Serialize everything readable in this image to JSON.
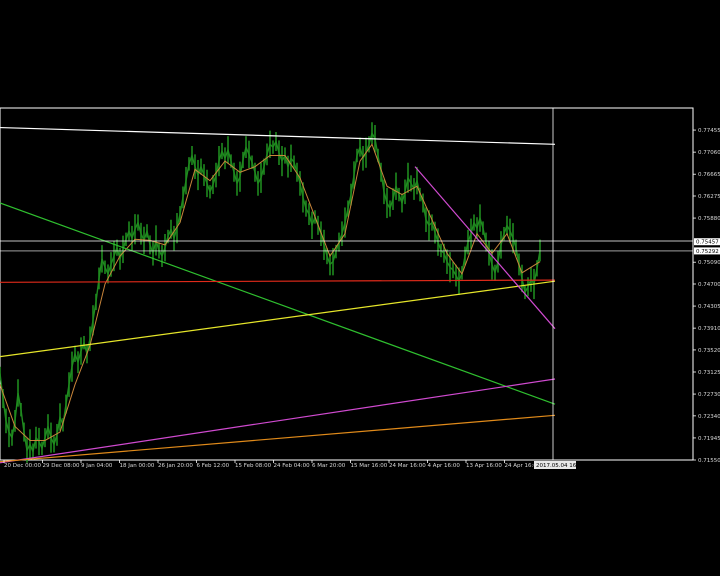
{
  "chart_data": {
    "type": "line",
    "style": {
      "background": "#000000",
      "frame_color": "#ffffff",
      "candle_color": "#1f8a1f",
      "ma_color": "#c8853a",
      "crosshair_color": "#ffffff",
      "tag_fill": "#ffffff",
      "tag_text": "#000000",
      "date_tag_fill": "#e8e8e8"
    },
    "grid": false,
    "x_tick_labels": [
      "20 Dec 00:00",
      "29 Dec 08:00",
      "9 Jan 04:00",
      "18 Jan 00:00",
      "26 Jan 20:00",
      "6 Feb 12:00",
      "15 Feb 08:00",
      "24 Feb 04:00",
      "6 Mar 20:00",
      "15 Mar 16:00",
      "24 Mar 16:00",
      "4 Apr 16:00",
      "13 Apr 16:00",
      "24 Apr 16:00"
    ],
    "y_tick_labels": [
      "0.77455",
      "0.77060",
      "0.76665",
      "0.76275",
      "0.75880",
      "0.75090",
      "0.74700",
      "0.74305",
      "0.73910",
      "0.73520",
      "0.73125",
      "0.72730",
      "0.72340",
      "0.71945",
      "0.71550"
    ],
    "ylim": [
      0.7155,
      0.7785
    ],
    "price_tags": [
      "0.75457",
      "0.75292"
    ],
    "crosshair_date_label": "2017.05.04 16:00",
    "price_series": [
      [
        0,
        0.731
      ],
      [
        3,
        0.7265
      ],
      [
        6,
        0.7225
      ],
      [
        9,
        0.7205
      ],
      [
        12,
        0.7195
      ],
      [
        15,
        0.7225
      ],
      [
        18,
        0.7275
      ],
      [
        21,
        0.7245
      ],
      [
        24,
        0.7205
      ],
      [
        27,
        0.7172
      ],
      [
        30,
        0.7183
      ],
      [
        33,
        0.717
      ],
      [
        36,
        0.7195
      ],
      [
        39,
        0.7188
      ],
      [
        42,
        0.7176
      ],
      [
        45,
        0.7195
      ],
      [
        48,
        0.7215
      ],
      [
        51,
        0.7195
      ],
      [
        54,
        0.7183
      ],
      [
        57,
        0.72
      ],
      [
        60,
        0.7232
      ],
      [
        63,
        0.7218
      ],
      [
        66,
        0.7255
      ],
      [
        69,
        0.729
      ],
      [
        72,
        0.7322
      ],
      [
        75,
        0.7345
      ],
      [
        78,
        0.733
      ],
      [
        81,
        0.735
      ],
      [
        84,
        0.7365
      ],
      [
        87,
        0.7345
      ],
      [
        90,
        0.7372
      ],
      [
        93,
        0.7405
      ],
      [
        96,
        0.7438
      ],
      [
        99,
        0.748
      ],
      [
        102,
        0.7515
      ],
      [
        105,
        0.75
      ],
      [
        108,
        0.7488
      ],
      [
        111,
        0.7505
      ],
      [
        114,
        0.752
      ],
      [
        117,
        0.7535
      ],
      [
        120,
        0.7515
      ],
      [
        123,
        0.7532
      ],
      [
        126,
        0.755
      ],
      [
        129,
        0.7565
      ],
      [
        132,
        0.7552
      ],
      [
        135,
        0.7568
      ],
      [
        138,
        0.758
      ],
      [
        141,
        0.756
      ],
      [
        144,
        0.7548
      ],
      [
        147,
        0.7565
      ],
      [
        150,
        0.754
      ],
      [
        153,
        0.7525
      ],
      [
        156,
        0.7548
      ],
      [
        159,
        0.753
      ],
      [
        162,
        0.752
      ],
      [
        165,
        0.7535
      ],
      [
        168,
        0.7555
      ],
      [
        171,
        0.7568
      ],
      [
        174,
        0.7552
      ],
      [
        177,
        0.757
      ],
      [
        180,
        0.7595
      ],
      [
        183,
        0.7625
      ],
      [
        186,
        0.7655
      ],
      [
        189,
        0.7685
      ],
      [
        192,
        0.77
      ],
      [
        195,
        0.768
      ],
      [
        198,
        0.7665
      ],
      [
        201,
        0.768
      ],
      [
        204,
        0.7665
      ],
      [
        207,
        0.765
      ],
      [
        210,
        0.7635
      ],
      [
        213,
        0.7648
      ],
      [
        216,
        0.7665
      ],
      [
        219,
        0.769
      ],
      [
        222,
        0.7708
      ],
      [
        225,
        0.7695
      ],
      [
        228,
        0.771
      ],
      [
        231,
        0.769
      ],
      [
        234,
        0.767
      ],
      [
        237,
        0.765
      ],
      [
        240,
        0.7662
      ],
      [
        243,
        0.7692
      ],
      [
        246,
        0.7715
      ],
      [
        249,
        0.7702
      ],
      [
        252,
        0.7688
      ],
      [
        255,
        0.767
      ],
      [
        258,
        0.765
      ],
      [
        261,
        0.766
      ],
      [
        264,
        0.768
      ],
      [
        267,
        0.7702
      ],
      [
        270,
        0.772
      ],
      [
        273,
        0.7715
      ],
      [
        276,
        0.7725
      ],
      [
        279,
        0.7705
      ],
      [
        282,
        0.769
      ],
      [
        285,
        0.77
      ],
      [
        288,
        0.768
      ],
      [
        291,
        0.7695
      ],
      [
        294,
        0.7688
      ],
      [
        297,
        0.767
      ],
      [
        300,
        0.765
      ],
      [
        303,
        0.7625
      ],
      [
        306,
        0.7605
      ],
      [
        309,
        0.7595
      ],
      [
        312,
        0.7575
      ],
      [
        315,
        0.759
      ],
      [
        318,
        0.7575
      ],
      [
        321,
        0.756
      ],
      [
        324,
        0.754
      ],
      [
        327,
        0.752
      ],
      [
        330,
        0.7505
      ],
      [
        333,
        0.751
      ],
      [
        336,
        0.7528
      ],
      [
        339,
        0.7545
      ],
      [
        342,
        0.756
      ],
      [
        345,
        0.758
      ],
      [
        348,
        0.7605
      ],
      [
        351,
        0.763
      ],
      [
        354,
        0.7665
      ],
      [
        357,
        0.77
      ],
      [
        360,
        0.7715
      ],
      [
        363,
        0.7695
      ],
      [
        366,
        0.7705
      ],
      [
        369,
        0.772
      ],
      [
        372,
        0.774
      ],
      [
        375,
        0.773
      ],
      [
        378,
        0.77
      ],
      [
        381,
        0.767
      ],
      [
        384,
        0.7635
      ],
      [
        387,
        0.7615
      ],
      [
        390,
        0.7605
      ],
      [
        393,
        0.7622
      ],
      [
        396,
        0.7645
      ],
      [
        399,
        0.763
      ],
      [
        402,
        0.7615
      ],
      [
        405,
        0.7635
      ],
      [
        408,
        0.766
      ],
      [
        411,
        0.765
      ],
      [
        414,
        0.764
      ],
      [
        417,
        0.7655
      ],
      [
        420,
        0.763
      ],
      [
        423,
        0.7615
      ],
      [
        426,
        0.7585
      ],
      [
        429,
        0.7575
      ],
      [
        432,
        0.758
      ],
      [
        435,
        0.7562
      ],
      [
        438,
        0.7545
      ],
      [
        441,
        0.753
      ],
      [
        444,
        0.7525
      ],
      [
        447,
        0.751
      ],
      [
        450,
        0.75
      ],
      [
        453,
        0.7495
      ],
      [
        456,
        0.7485
      ],
      [
        459,
        0.7475
      ],
      [
        462,
        0.749
      ],
      [
        465,
        0.752
      ],
      [
        468,
        0.7545
      ],
      [
        471,
        0.756
      ],
      [
        474,
        0.758
      ],
      [
        477,
        0.757
      ],
      [
        480,
        0.7588
      ],
      [
        483,
        0.757
      ],
      [
        486,
        0.7545
      ],
      [
        489,
        0.7525
      ],
      [
        492,
        0.7505
      ],
      [
        495,
        0.749
      ],
      [
        498,
        0.751
      ],
      [
        501,
        0.754
      ],
      [
        504,
        0.756
      ],
      [
        507,
        0.7575
      ],
      [
        510,
        0.7565
      ],
      [
        513,
        0.7552
      ],
      [
        516,
        0.7535
      ],
      [
        519,
        0.7505
      ],
      [
        522,
        0.748
      ],
      [
        525,
        0.7455
      ],
      [
        528,
        0.7465
      ],
      [
        531,
        0.7478
      ],
      [
        534,
        0.747
      ],
      [
        537,
        0.7498
      ],
      [
        540,
        0.753
      ]
    ],
    "moving_average": [
      [
        0,
        0.729
      ],
      [
        15,
        0.7215
      ],
      [
        30,
        0.719
      ],
      [
        45,
        0.719
      ],
      [
        60,
        0.7205
      ],
      [
        75,
        0.729
      ],
      [
        90,
        0.736
      ],
      [
        105,
        0.747
      ],
      [
        120,
        0.752
      ],
      [
        135,
        0.755
      ],
      [
        150,
        0.7548
      ],
      [
        165,
        0.754
      ],
      [
        180,
        0.758
      ],
      [
        195,
        0.7675
      ],
      [
        210,
        0.7655
      ],
      [
        225,
        0.769
      ],
      [
        240,
        0.767
      ],
      [
        255,
        0.768
      ],
      [
        270,
        0.77
      ],
      [
        285,
        0.77
      ],
      [
        300,
        0.766
      ],
      [
        315,
        0.759
      ],
      [
        330,
        0.752
      ],
      [
        345,
        0.756
      ],
      [
        360,
        0.769
      ],
      [
        372,
        0.772
      ],
      [
        387,
        0.7645
      ],
      [
        402,
        0.763
      ],
      [
        417,
        0.7645
      ],
      [
        432,
        0.7585
      ],
      [
        447,
        0.7525
      ],
      [
        462,
        0.7488
      ],
      [
        477,
        0.756
      ],
      [
        492,
        0.7525
      ],
      [
        507,
        0.756
      ],
      [
        522,
        0.749
      ],
      [
        540,
        0.751
      ]
    ],
    "trendlines": [
      {
        "color": "#ffffff",
        "points": [
          [
            0,
            0.775
          ],
          [
            555,
            0.772
          ]
        ]
      },
      {
        "color": "#2fbf2f",
        "points": [
          [
            0,
            0.7615
          ],
          [
            555,
            0.7255
          ]
        ]
      },
      {
        "color": "#e02a1a",
        "points": [
          [
            0,
            0.7473
          ],
          [
            555,
            0.7477
          ]
        ]
      },
      {
        "color": "#e6e62a",
        "points": [
          [
            0,
            0.734
          ],
          [
            555,
            0.7475
          ]
        ]
      },
      {
        "color": "#d04ad0",
        "points": [
          [
            415,
            0.768
          ],
          [
            555,
            0.739
          ]
        ]
      },
      {
        "color": "#d04ad0",
        "points": [
          [
            0,
            0.715
          ],
          [
            555,
            0.73
          ]
        ]
      },
      {
        "color": "#e08a1a",
        "points": [
          [
            0,
            0.7152
          ],
          [
            555,
            0.7235
          ]
        ]
      }
    ]
  }
}
